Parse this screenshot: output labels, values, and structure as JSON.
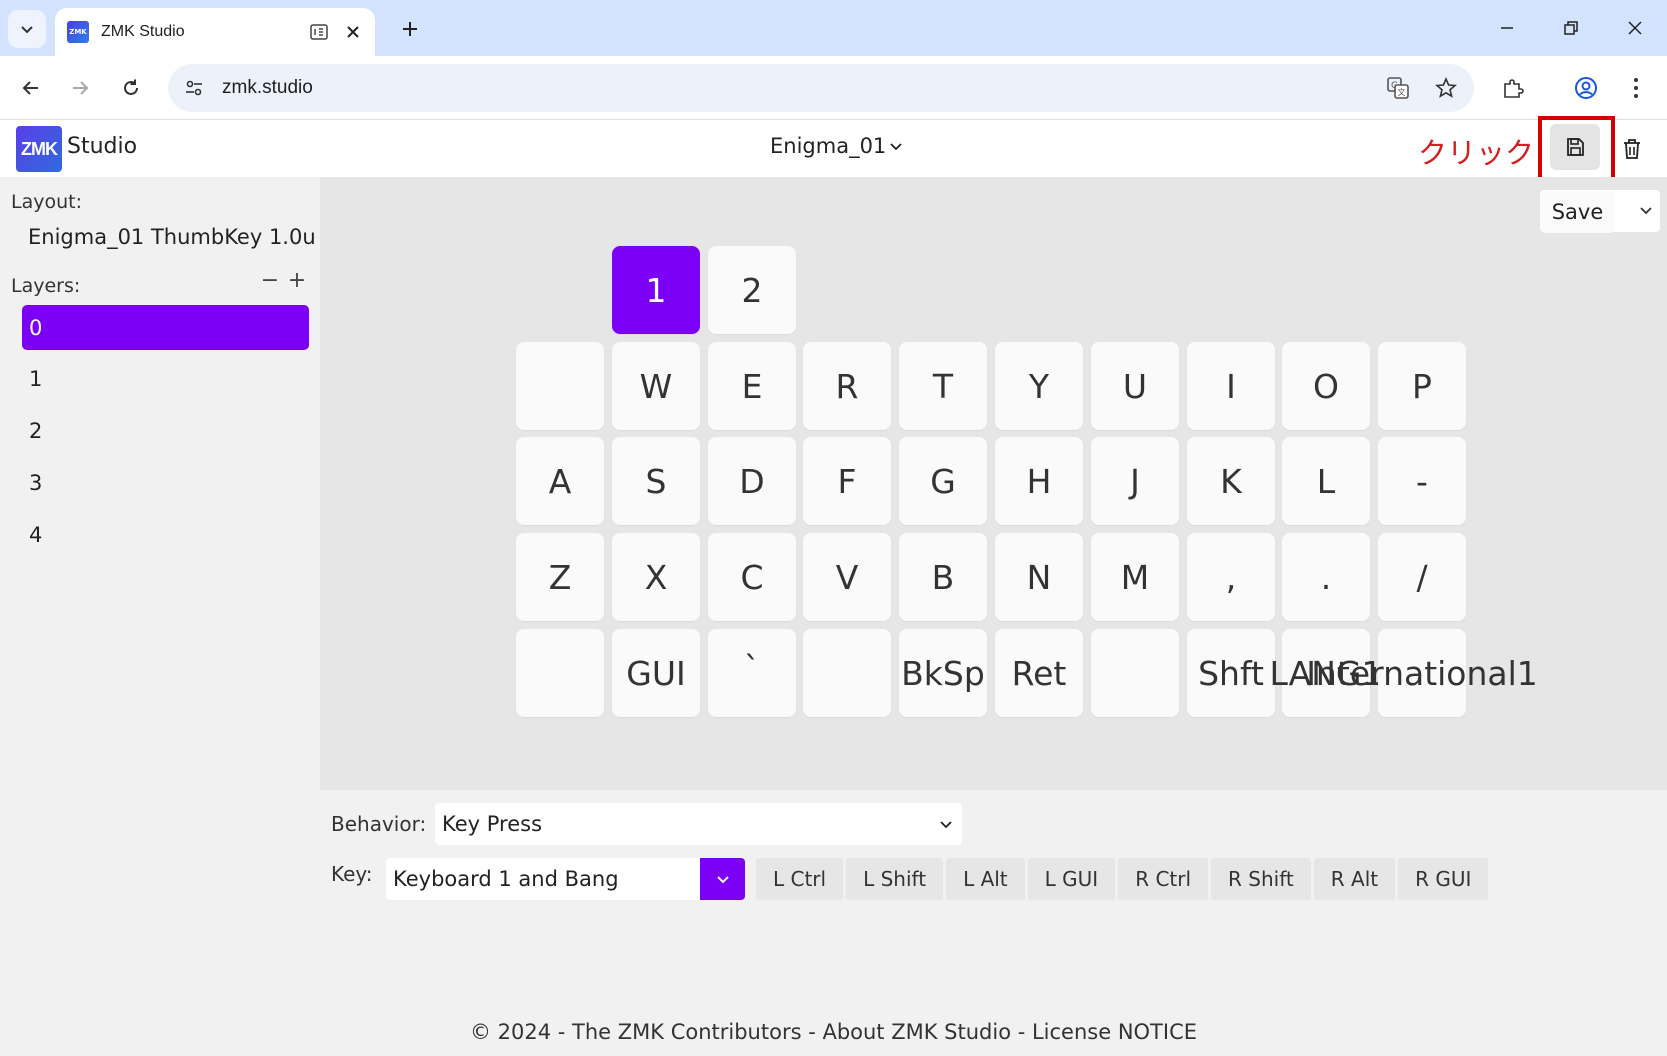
{
  "browser": {
    "tab_title": "ZMK Studio",
    "favicon_text": "ZMK",
    "url": "zmk.studio"
  },
  "header": {
    "logo_text": "ZMK",
    "brand": "Studio",
    "keyboard_name": "Enigma_01",
    "annotation": "クリック",
    "save_tooltip": "Save"
  },
  "sidebar": {
    "layout_label": "Layout:",
    "layout_name": "Enigma_01 ThumbKey 1.0u",
    "layers_label": "Layers:",
    "remove_symbol": "−",
    "add_symbol": "+",
    "layers": [
      "0",
      "1",
      "2",
      "3",
      "4"
    ],
    "active_layer": "0"
  },
  "keyboard": {
    "row0": [
      "1",
      "2"
    ],
    "row1": [
      "",
      "W",
      "E",
      "R",
      "T",
      "Y",
      "U",
      "I",
      "O",
      "P"
    ],
    "row2": [
      "A",
      "S",
      "D",
      "F",
      "G",
      "H",
      "J",
      "K",
      "L",
      "-"
    ],
    "row3": [
      "Z",
      "X",
      "C",
      "V",
      "B",
      "N",
      "M",
      ",",
      ".",
      "/"
    ],
    "row4": [
      "",
      "GUI",
      "`",
      "",
      "BkSp",
      "Ret",
      "",
      "Shft",
      "LANG1",
      "International1"
    ],
    "selected_key": "1"
  },
  "editor": {
    "behavior_label": "Behavior:",
    "behavior_value": "Key Press",
    "key_label": "Key:",
    "key_value": "Keyboard 1 and Bang",
    "modifiers": [
      "L Ctrl",
      "L Shift",
      "L Alt",
      "L GUI",
      "R Ctrl",
      "R Shift",
      "R Alt",
      "R GUI"
    ]
  },
  "footer": {
    "text": "© 2024 - The ZMK Contributors - About ZMK Studio - License NOTICE"
  },
  "colors": {
    "accent": "#7c00f6",
    "annotation": "#d42020"
  }
}
